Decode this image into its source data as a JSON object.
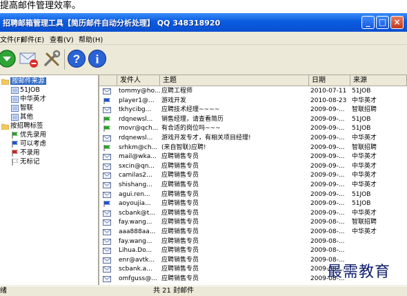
{
  "caption": "提高邮件管理效率。",
  "window": {
    "title": "招聘邮箱管理工具【简历邮件自动分析处理】 QQ 348318920",
    "min_label": "_",
    "max_label": "□",
    "close_label": "×"
  },
  "menu": [
    {
      "label": "文件(F)"
    },
    {
      "label": "邮件(E)"
    },
    {
      "label": "查看(V)"
    },
    {
      "label": "帮助(H)"
    }
  ],
  "tree": {
    "group1": "按邮件来源",
    "group1_items": [
      "51JOB",
      "中华英才",
      "智联",
      "其他"
    ],
    "group2": "按招聘标签",
    "group2_items": [
      {
        "label": "优先录用",
        "color": "#2aa52a"
      },
      {
        "label": "可以考虑",
        "color": "#1f4fd6"
      },
      {
        "label": "不录用",
        "color": "#d42020"
      },
      {
        "label": "无标记",
        "color": ""
      }
    ]
  },
  "table": {
    "headers": [
      "发件人",
      "主题",
      "日期",
      "来源"
    ],
    "rows": [
      {
        "icon": "env",
        "sender": "tommy@ho...",
        "subject": "应聘工程师",
        "date": "2010-07-11",
        "source": "51JOB"
      },
      {
        "icon": "flag-blue",
        "sender": "player1@...",
        "subject": "游戏开发",
        "date": "2010-08-23",
        "source": "中华英才"
      },
      {
        "icon": "env",
        "sender": "tkhycibg...",
        "subject": "应聘技术经理~~~~",
        "date": "2009-09-...",
        "source": "智联招聘"
      },
      {
        "icon": "flag-green",
        "sender": "rdqnewsl...",
        "subject": "销售经理，请查看简历",
        "date": "2009-09-...",
        "source": "51JOB"
      },
      {
        "icon": "flag-green",
        "sender": "movr@qch...",
        "subject": "有合适的岗位吗~~~",
        "date": "2009-09-...",
        "source": "51JOB"
      },
      {
        "icon": "env",
        "sender": "rdqnewsl...",
        "subject": "游戏开发专才，有相关项目经理!",
        "date": "2009-09-...",
        "source": "中华英才"
      },
      {
        "icon": "flag-green",
        "sender": "srhkm@ch...",
        "subject": "(来自智联)应聘!",
        "date": "2009-09-...",
        "source": "智联招聘"
      },
      {
        "icon": "env",
        "sender": "mail@wka...",
        "subject": "应聘销售专员",
        "date": "2009-09-...",
        "source": "中华英才"
      },
      {
        "icon": "env",
        "sender": "sxcin@qn...",
        "subject": "应聘销售专员",
        "date": "2009-09-...",
        "source": "中华英才"
      },
      {
        "icon": "env",
        "sender": "camilas2...",
        "subject": "应聘销售专员",
        "date": "2009-09-...",
        "source": "中华英才"
      },
      {
        "icon": "env",
        "sender": "shishang...",
        "subject": "应聘销售专员",
        "date": "2009-09-...",
        "source": "中华英才"
      },
      {
        "icon": "env",
        "sender": "agui.ren...",
        "subject": "应聘销售专员",
        "date": "2009-09-...",
        "source": "51JOB"
      },
      {
        "icon": "flag-blue",
        "sender": "aoyoujia...",
        "subject": "应聘销售专员",
        "date": "2009-09-...",
        "source": "51JOB"
      },
      {
        "icon": "env",
        "sender": "scbank@t...",
        "subject": "应聘销售专员",
        "date": "2009-09-...",
        "source": "中华英才"
      },
      {
        "icon": "env",
        "sender": "fay.wang...",
        "subject": "应聘销售专员",
        "date": "2009-08-...",
        "source": "智联招聘"
      },
      {
        "icon": "env",
        "sender": "aaa888aa...",
        "subject": "应聘销售专员",
        "date": "2009-08-...",
        "source": "中华英才"
      },
      {
        "icon": "env",
        "sender": "fay.wang...",
        "subject": "应聘销售专员",
        "date": "2009-08-...",
        "source": ""
      },
      {
        "icon": "env",
        "sender": "Lihua.Do...",
        "subject": "应聘销售专员",
        "date": "2009-08-...",
        "source": ""
      },
      {
        "icon": "env",
        "sender": "enr@avtk...",
        "subject": "应聘销售专员",
        "date": "2009-08-...",
        "source": ""
      },
      {
        "icon": "env",
        "sender": "scbank.a...",
        "subject": "应聘销售专员",
        "date": "2009-08-...",
        "source": ""
      },
      {
        "icon": "env",
        "sender": "omfguss@...",
        "subject": "应聘销售专员",
        "date": "2009-08-...",
        "source": ""
      }
    ]
  },
  "status": {
    "left": "绪",
    "center": "共 21 封邮件"
  },
  "watermark": "最需教育"
}
